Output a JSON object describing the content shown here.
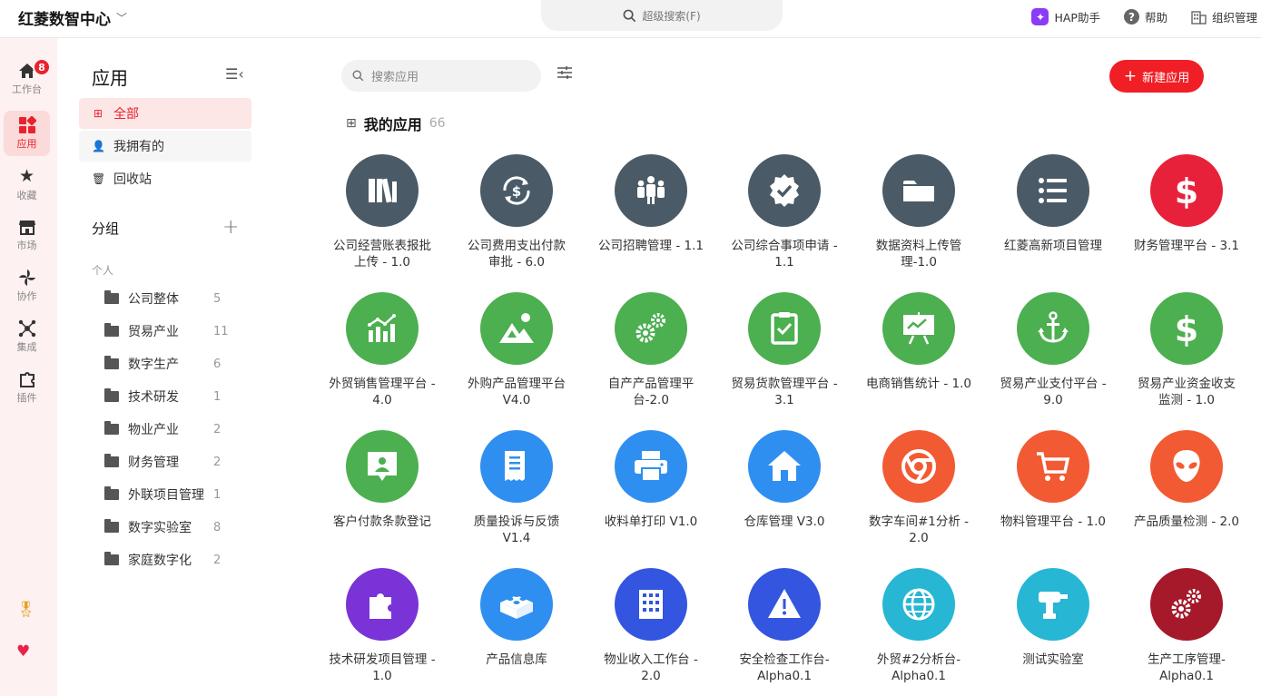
{
  "topbar": {
    "org_name": "红菱数智中心",
    "search_placeholder": "超级搜索(F)",
    "hap_label": "HAP助手",
    "help_label": "帮助",
    "org_manage_label": "组织管理"
  },
  "rail": {
    "items": [
      {
        "label": "工作台",
        "badge": "8"
      },
      {
        "label": "应用"
      },
      {
        "label": "收藏"
      },
      {
        "label": "市场"
      },
      {
        "label": "协作"
      },
      {
        "label": "集成"
      },
      {
        "label": "插件"
      }
    ]
  },
  "sidebar": {
    "title": "应用",
    "nav": [
      {
        "label": "全部"
      },
      {
        "label": "我拥有的"
      },
      {
        "label": "回收站"
      }
    ],
    "group_title": "分组",
    "personal_label": "个人",
    "groups": [
      {
        "name": "公司整体",
        "count": "5"
      },
      {
        "name": "贸易产业",
        "count": "11"
      },
      {
        "name": "数字生产",
        "count": "6"
      },
      {
        "name": "技术研发",
        "count": "1"
      },
      {
        "name": "物业产业",
        "count": "2"
      },
      {
        "name": "财务管理",
        "count": "2"
      },
      {
        "name": "外联项目管理",
        "count": "1"
      },
      {
        "name": "数字实验室",
        "count": "8"
      },
      {
        "name": "家庭数字化",
        "count": "2"
      }
    ]
  },
  "main": {
    "search_placeholder": "搜索应用",
    "new_button": "新建应用",
    "section_title": "我的应用",
    "section_count": "66",
    "apps": [
      {
        "name": "公司经营账表报批上传 - 1.0",
        "color": "#4a5a66",
        "icon": "books-icon"
      },
      {
        "name": "公司费用支出付款审批 - 6.0",
        "color": "#4a5a66",
        "icon": "dollar-cycle-icon"
      },
      {
        "name": "公司招聘管理 - 1.1",
        "color": "#4a5a66",
        "icon": "people-icon"
      },
      {
        "name": "公司综合事项申请 - 1.1",
        "color": "#4a5a66",
        "icon": "verified-badge-icon"
      },
      {
        "name": "数据资料上传管理-1.0",
        "color": "#4a5a66",
        "icon": "folder-icon"
      },
      {
        "name": "红菱高新项目管理",
        "color": "#4a5a66",
        "icon": "list-icon"
      },
      {
        "name": "财务管理平台 - 3.1",
        "color": "#e8213a",
        "icon": "dollar-icon"
      },
      {
        "name": "外贸销售管理平台 - 4.0",
        "color": "#4caf50",
        "icon": "bar-chart-icon"
      },
      {
        "name": "外购产品管理平台 V4.0",
        "color": "#4caf50",
        "icon": "landscape-icon"
      },
      {
        "name": "自产产品管理平台-2.0",
        "color": "#4caf50",
        "icon": "gears-icon"
      },
      {
        "name": "贸易货款管理平台 - 3.1",
        "color": "#4caf50",
        "icon": "clipboard-check-icon"
      },
      {
        "name": "电商销售统计 - 1.0",
        "color": "#4caf50",
        "icon": "presentation-icon"
      },
      {
        "name": "贸易产业支付平台 - 9.0",
        "color": "#4caf50",
        "icon": "anchor-icon"
      },
      {
        "name": "贸易产业资金收支监测 - 1.0",
        "color": "#4caf50",
        "icon": "dollar-icon"
      },
      {
        "name": "客户付款条款登记",
        "color": "#4caf50",
        "icon": "contact-card-icon"
      },
      {
        "name": "质量投诉与反馈 V1.4",
        "color": "#2f8ff0",
        "icon": "receipt-icon"
      },
      {
        "name": "收料单打印 V1.0",
        "color": "#2f8ff0",
        "icon": "printer-icon"
      },
      {
        "name": "仓库管理 V3.0",
        "color": "#2f8ff0",
        "icon": "house-icon"
      },
      {
        "name": "数字车间#1分析 - 2.0",
        "color": "#f25a33",
        "icon": "chrome-icon"
      },
      {
        "name": "物料管理平台 - 1.0",
        "color": "#f25a33",
        "icon": "cart-icon"
      },
      {
        "name": "产品质量检测 - 2.0",
        "color": "#f25a33",
        "icon": "alien-icon"
      },
      {
        "name": "技术研发项目管理 - 1.0",
        "color": "#7a33d6",
        "icon": "puzzle-icon"
      },
      {
        "name": "产品信息库",
        "color": "#2f8ff0",
        "icon": "lego-brick-icon"
      },
      {
        "name": "物业收入工作台 - 2.0",
        "color": "#3355e0",
        "icon": "building-icon"
      },
      {
        "name": "安全检查工作台- Alpha0.1",
        "color": "#3355e0",
        "icon": "warning-icon"
      },
      {
        "name": "外贸#2分析台-Alpha0.1",
        "color": "#27b6d4",
        "icon": "globe-icon"
      },
      {
        "name": "测试实验室",
        "color": "#27b6d4",
        "icon": "drill-icon"
      },
      {
        "name": "生产工序管理-Alpha0.1",
        "color": "#a5192a",
        "icon": "gears-icon"
      }
    ]
  }
}
